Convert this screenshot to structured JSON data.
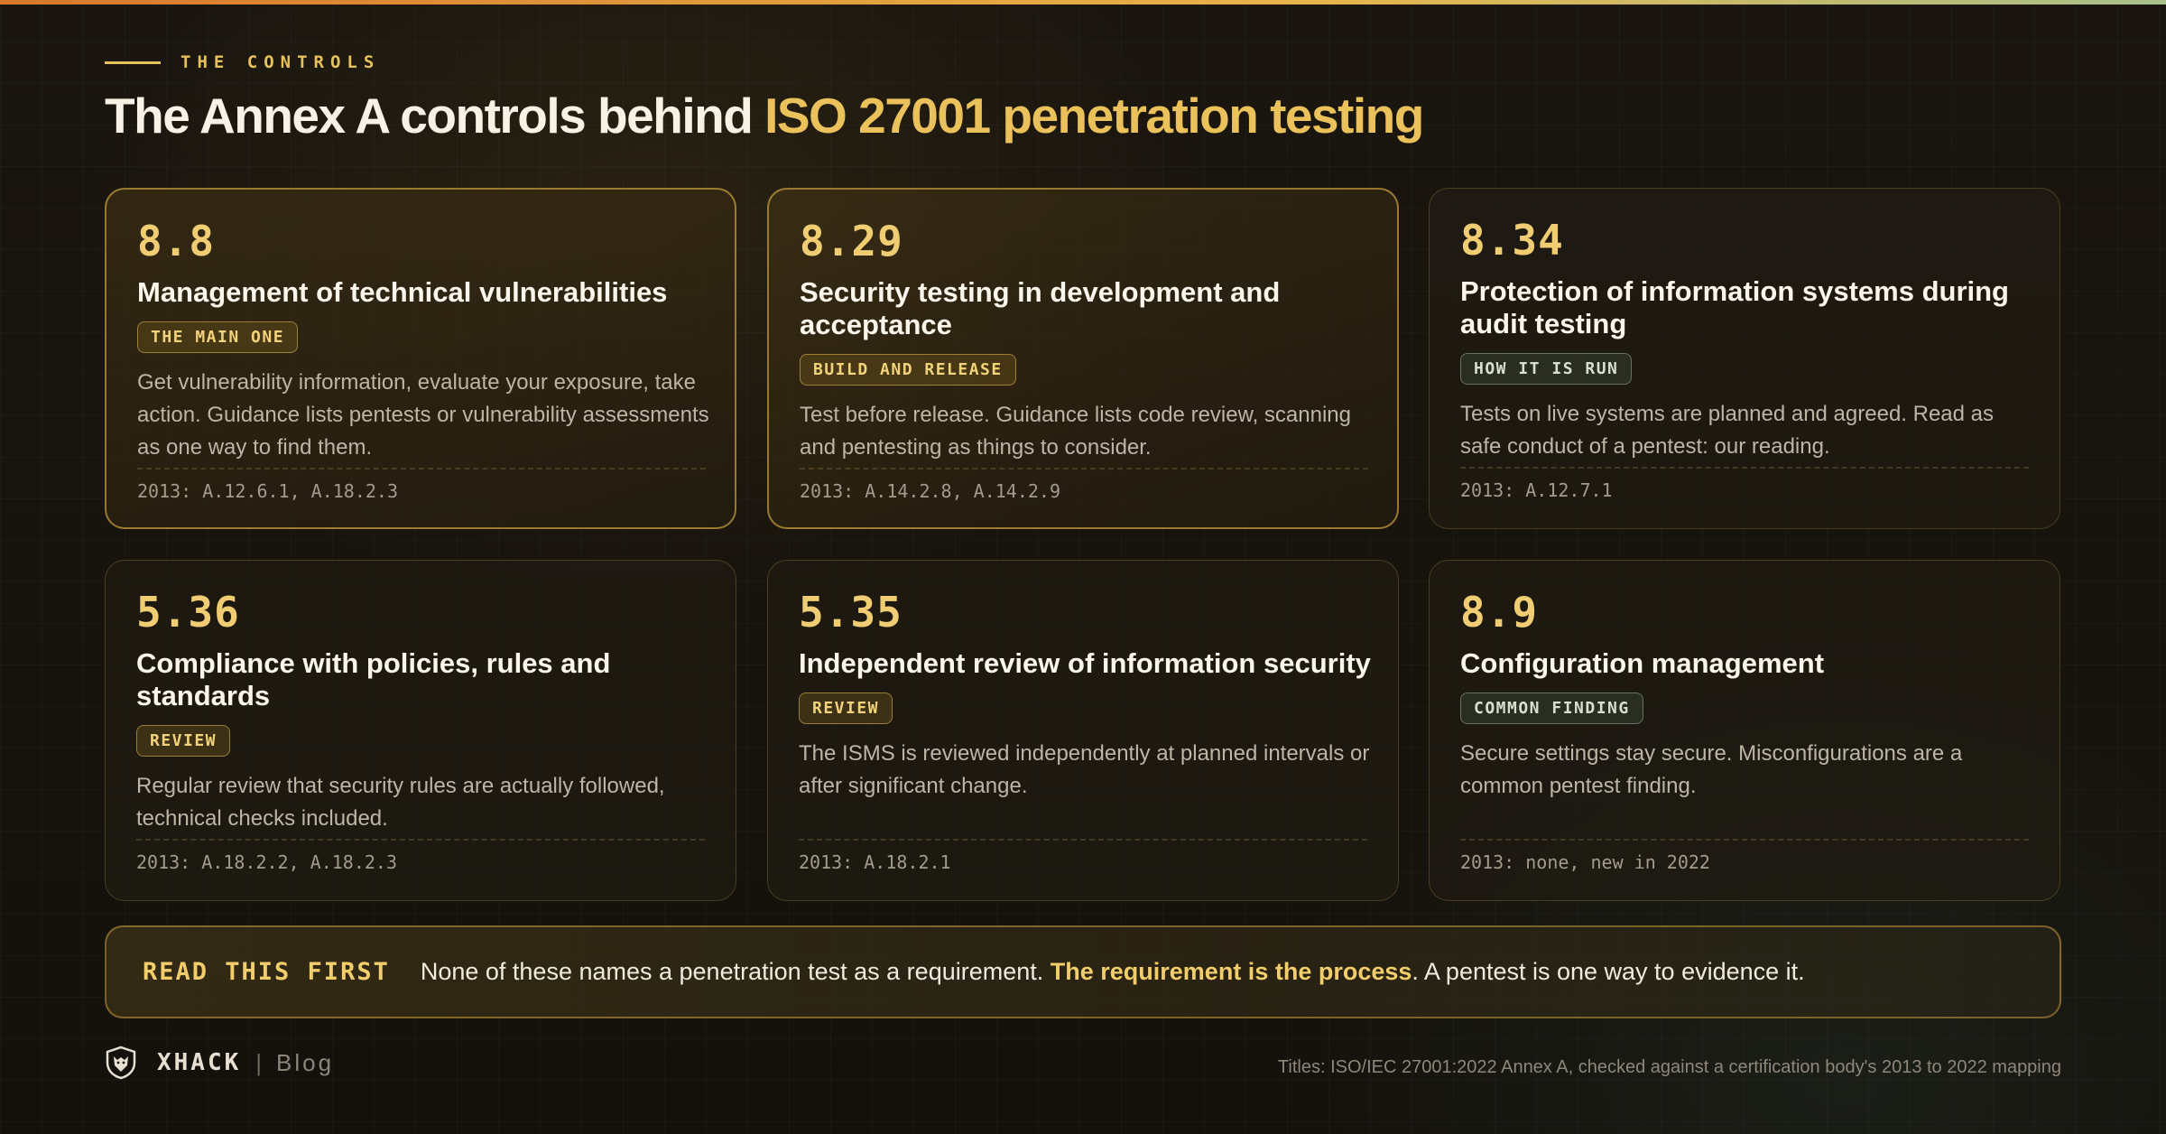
{
  "header": {
    "eyebrow": "THE CONTROLS",
    "title_main": "The Annex A controls behind ",
    "title_accent": "ISO 27001 penetration testing"
  },
  "cards": [
    {
      "number": "8.8",
      "title": "Management of technical vulnerabilities",
      "tag": "THE MAIN ONE",
      "description": "Get vulnerability information, evaluate your exposure, take action. Guidance lists pentests or vulnerability assessments as one way to find them.",
      "ref": "2013: A.12.6.1, A.18.2.3"
    },
    {
      "number": "8.29",
      "title": "Security testing in development and acceptance",
      "tag": "BUILD AND RELEASE",
      "description": "Test before release. Guidance lists code review, scanning and pentesting as things to consider.",
      "ref": "2013: A.14.2.8, A.14.2.9"
    },
    {
      "number": "8.34",
      "title": "Protection of information systems during audit testing",
      "tag": "HOW IT IS RUN",
      "description": "Tests on live systems are planned and agreed. Read as safe conduct of a pentest: our reading.",
      "ref": "2013: A.12.7.1"
    },
    {
      "number": "5.36",
      "title": "Compliance with policies, rules and standards",
      "tag": "REVIEW",
      "description": "Regular review that security rules are actually followed, technical checks included.",
      "ref": "2013: A.18.2.2, A.18.2.3"
    },
    {
      "number": "5.35",
      "title": "Independent review of information security",
      "tag": "REVIEW",
      "description": "The ISMS is reviewed independently at planned intervals or after significant change.",
      "ref": "2013: A.18.2.1"
    },
    {
      "number": "8.9",
      "title": "Configuration management",
      "tag": "COMMON FINDING",
      "description": "Secure settings stay secure. Misconfigurations are a common pentest finding.",
      "ref": "2013: none, new in 2022"
    }
  ],
  "callout": {
    "label": "READ THIS FIRST",
    "text_before": "None of these names a penetration test as a requirement. ",
    "highlight": "The requirement is the process",
    "text_after": ". A pentest is one way to evidence it."
  },
  "footer": {
    "brand": "XHACK",
    "separator": "|",
    "section": "Blog",
    "note": "Titles: ISO/IEC 27001:2022 Annex A, checked against a certification body's 2013 to 2022 mapping"
  },
  "icons": {
    "logo": "wolf-shield-icon"
  },
  "colors": {
    "accent": "#eac15a",
    "background": "#15120d",
    "tag_green": "#d6e0cc"
  }
}
